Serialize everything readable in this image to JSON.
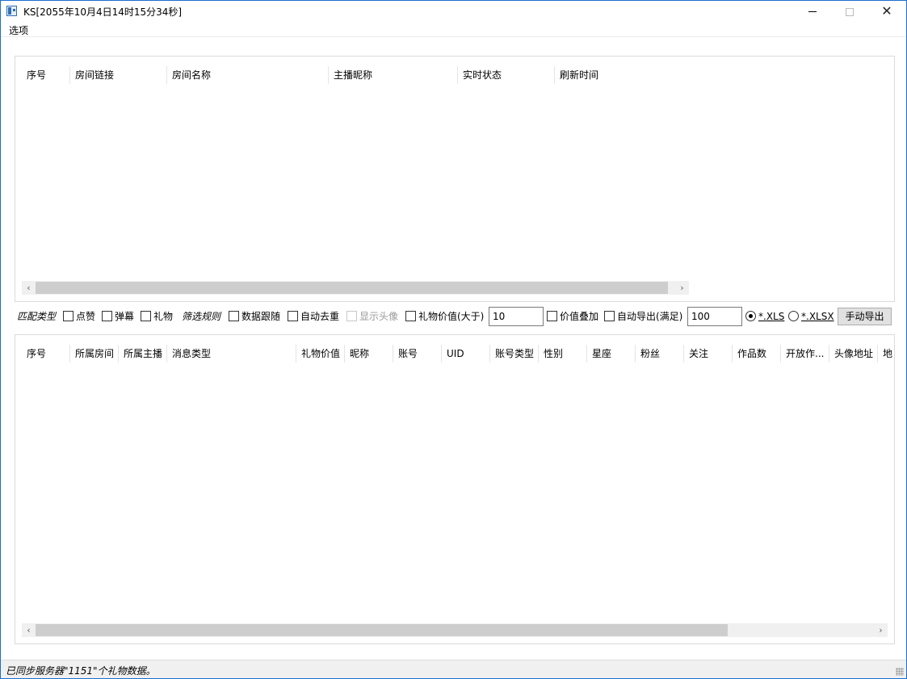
{
  "window": {
    "title": "KS[2055年10月4日14时15分34秒]",
    "controls": {
      "minimize": "minimize-icon",
      "maximize": "maximize-icon",
      "close": "✕"
    }
  },
  "menu": {
    "items": [
      {
        "label": "选项"
      }
    ]
  },
  "room_table": {
    "columns": [
      "序号",
      "房间链接",
      "房间名称",
      "主播昵称",
      "实时状态",
      "刷新时间"
    ],
    "rows": []
  },
  "toolbar": {
    "match_type_label": "匹配类型",
    "match_options": [
      {
        "label": "点赞",
        "checked": false
      },
      {
        "label": "弹幕",
        "checked": false
      },
      {
        "label": "礼物",
        "checked": false
      }
    ],
    "filter_rule_label": "筛选规则",
    "data_follow": {
      "label": "数据跟随",
      "checked": false
    },
    "auto_dedupe": {
      "label": "自动去重",
      "checked": false
    },
    "show_avatar": {
      "label": "显示头像",
      "checked": false,
      "disabled": true
    },
    "gift_value_gt": {
      "label": "礼物价值(大于)",
      "checked": false,
      "value": "10"
    },
    "value_stack": {
      "label": "价值叠加",
      "checked": false
    },
    "auto_export": {
      "label": "自动导出(满足)",
      "checked": false,
      "value": "100"
    },
    "format_options": [
      {
        "label": "*.XLS",
        "selected": true
      },
      {
        "label": "*.XLSX",
        "selected": false
      }
    ],
    "manual_export_label": "手动导出"
  },
  "message_table": {
    "columns": [
      "序号",
      "所属房间",
      "所属主播",
      "消息类型",
      "礼物价值",
      "昵称",
      "账号",
      "UID",
      "账号类型",
      "性别",
      "星座",
      "粉丝",
      "关注",
      "作品数",
      "开放作...",
      "头像地址",
      "地"
    ],
    "rows": []
  },
  "status": {
    "text": "已同步服务器\"1151\"个礼物数据。"
  },
  "scroll_icons": {
    "left": "‹",
    "right": "›"
  }
}
